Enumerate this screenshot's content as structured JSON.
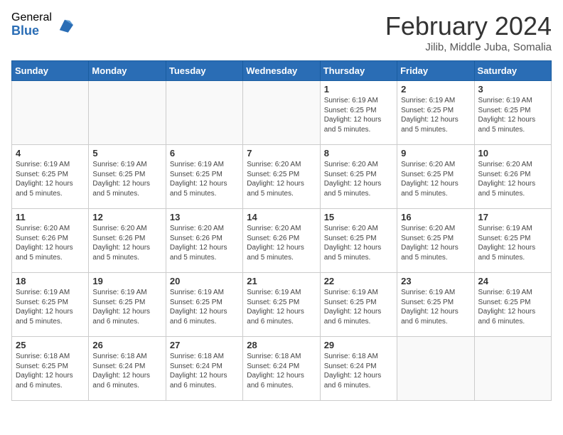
{
  "logo": {
    "general": "General",
    "blue": "Blue"
  },
  "header": {
    "title": "February 2024",
    "subtitle": "Jilib, Middle Juba, Somalia"
  },
  "days_of_week": [
    "Sunday",
    "Monday",
    "Tuesday",
    "Wednesday",
    "Thursday",
    "Friday",
    "Saturday"
  ],
  "weeks": [
    [
      {
        "day": "",
        "info": ""
      },
      {
        "day": "",
        "info": ""
      },
      {
        "day": "",
        "info": ""
      },
      {
        "day": "",
        "info": ""
      },
      {
        "day": "1",
        "info": "Sunrise: 6:19 AM\nSunset: 6:25 PM\nDaylight: 12 hours\nand 5 minutes."
      },
      {
        "day": "2",
        "info": "Sunrise: 6:19 AM\nSunset: 6:25 PM\nDaylight: 12 hours\nand 5 minutes."
      },
      {
        "day": "3",
        "info": "Sunrise: 6:19 AM\nSunset: 6:25 PM\nDaylight: 12 hours\nand 5 minutes."
      }
    ],
    [
      {
        "day": "4",
        "info": "Sunrise: 6:19 AM\nSunset: 6:25 PM\nDaylight: 12 hours\nand 5 minutes."
      },
      {
        "day": "5",
        "info": "Sunrise: 6:19 AM\nSunset: 6:25 PM\nDaylight: 12 hours\nand 5 minutes."
      },
      {
        "day": "6",
        "info": "Sunrise: 6:19 AM\nSunset: 6:25 PM\nDaylight: 12 hours\nand 5 minutes."
      },
      {
        "day": "7",
        "info": "Sunrise: 6:20 AM\nSunset: 6:25 PM\nDaylight: 12 hours\nand 5 minutes."
      },
      {
        "day": "8",
        "info": "Sunrise: 6:20 AM\nSunset: 6:25 PM\nDaylight: 12 hours\nand 5 minutes."
      },
      {
        "day": "9",
        "info": "Sunrise: 6:20 AM\nSunset: 6:25 PM\nDaylight: 12 hours\nand 5 minutes."
      },
      {
        "day": "10",
        "info": "Sunrise: 6:20 AM\nSunset: 6:26 PM\nDaylight: 12 hours\nand 5 minutes."
      }
    ],
    [
      {
        "day": "11",
        "info": "Sunrise: 6:20 AM\nSunset: 6:26 PM\nDaylight: 12 hours\nand 5 minutes."
      },
      {
        "day": "12",
        "info": "Sunrise: 6:20 AM\nSunset: 6:26 PM\nDaylight: 12 hours\nand 5 minutes."
      },
      {
        "day": "13",
        "info": "Sunrise: 6:20 AM\nSunset: 6:26 PM\nDaylight: 12 hours\nand 5 minutes."
      },
      {
        "day": "14",
        "info": "Sunrise: 6:20 AM\nSunset: 6:26 PM\nDaylight: 12 hours\nand 5 minutes."
      },
      {
        "day": "15",
        "info": "Sunrise: 6:20 AM\nSunset: 6:25 PM\nDaylight: 12 hours\nand 5 minutes."
      },
      {
        "day": "16",
        "info": "Sunrise: 6:20 AM\nSunset: 6:25 PM\nDaylight: 12 hours\nand 5 minutes."
      },
      {
        "day": "17",
        "info": "Sunrise: 6:19 AM\nSunset: 6:25 PM\nDaylight: 12 hours\nand 5 minutes."
      }
    ],
    [
      {
        "day": "18",
        "info": "Sunrise: 6:19 AM\nSunset: 6:25 PM\nDaylight: 12 hours\nand 5 minutes."
      },
      {
        "day": "19",
        "info": "Sunrise: 6:19 AM\nSunset: 6:25 PM\nDaylight: 12 hours\nand 6 minutes."
      },
      {
        "day": "20",
        "info": "Sunrise: 6:19 AM\nSunset: 6:25 PM\nDaylight: 12 hours\nand 6 minutes."
      },
      {
        "day": "21",
        "info": "Sunrise: 6:19 AM\nSunset: 6:25 PM\nDaylight: 12 hours\nand 6 minutes."
      },
      {
        "day": "22",
        "info": "Sunrise: 6:19 AM\nSunset: 6:25 PM\nDaylight: 12 hours\nand 6 minutes."
      },
      {
        "day": "23",
        "info": "Sunrise: 6:19 AM\nSunset: 6:25 PM\nDaylight: 12 hours\nand 6 minutes."
      },
      {
        "day": "24",
        "info": "Sunrise: 6:19 AM\nSunset: 6:25 PM\nDaylight: 12 hours\nand 6 minutes."
      }
    ],
    [
      {
        "day": "25",
        "info": "Sunrise: 6:18 AM\nSunset: 6:25 PM\nDaylight: 12 hours\nand 6 minutes."
      },
      {
        "day": "26",
        "info": "Sunrise: 6:18 AM\nSunset: 6:24 PM\nDaylight: 12 hours\nand 6 minutes."
      },
      {
        "day": "27",
        "info": "Sunrise: 6:18 AM\nSunset: 6:24 PM\nDaylight: 12 hours\nand 6 minutes."
      },
      {
        "day": "28",
        "info": "Sunrise: 6:18 AM\nSunset: 6:24 PM\nDaylight: 12 hours\nand 6 minutes."
      },
      {
        "day": "29",
        "info": "Sunrise: 6:18 AM\nSunset: 6:24 PM\nDaylight: 12 hours\nand 6 minutes."
      },
      {
        "day": "",
        "info": ""
      },
      {
        "day": "",
        "info": ""
      }
    ]
  ]
}
